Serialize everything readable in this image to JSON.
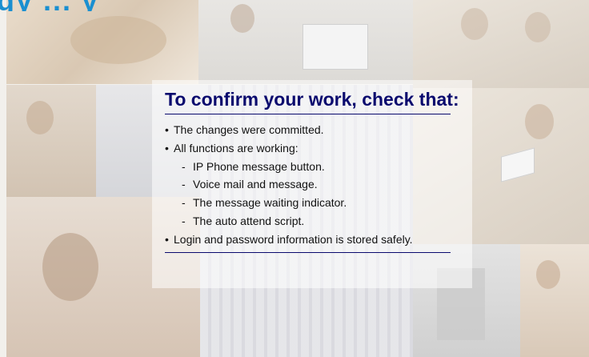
{
  "slide": {
    "top_banner_text": "gy              ...              y",
    "heading": "To confirm your work, check that:",
    "bullets": [
      {
        "level": 1,
        "marker": "•",
        "text": "The changes were committed."
      },
      {
        "level": 1,
        "marker": "•",
        "text": "All functions are working:"
      },
      {
        "level": 2,
        "marker": "-",
        "text": "IP Phone message button."
      },
      {
        "level": 2,
        "marker": "-",
        "text": "Voice mail and message."
      },
      {
        "level": 2,
        "marker": "-",
        "text": "The message waiting indicator."
      },
      {
        "level": 2,
        "marker": "-",
        "text": "The auto attend script."
      },
      {
        "level": 1,
        "marker": "•",
        "text": "Login and password information is stored safely."
      }
    ]
  },
  "colors": {
    "heading": "#0a0a6e",
    "body_text": "#111111",
    "banner_text": "#1a8fd0",
    "background": "#f2f0ec"
  }
}
